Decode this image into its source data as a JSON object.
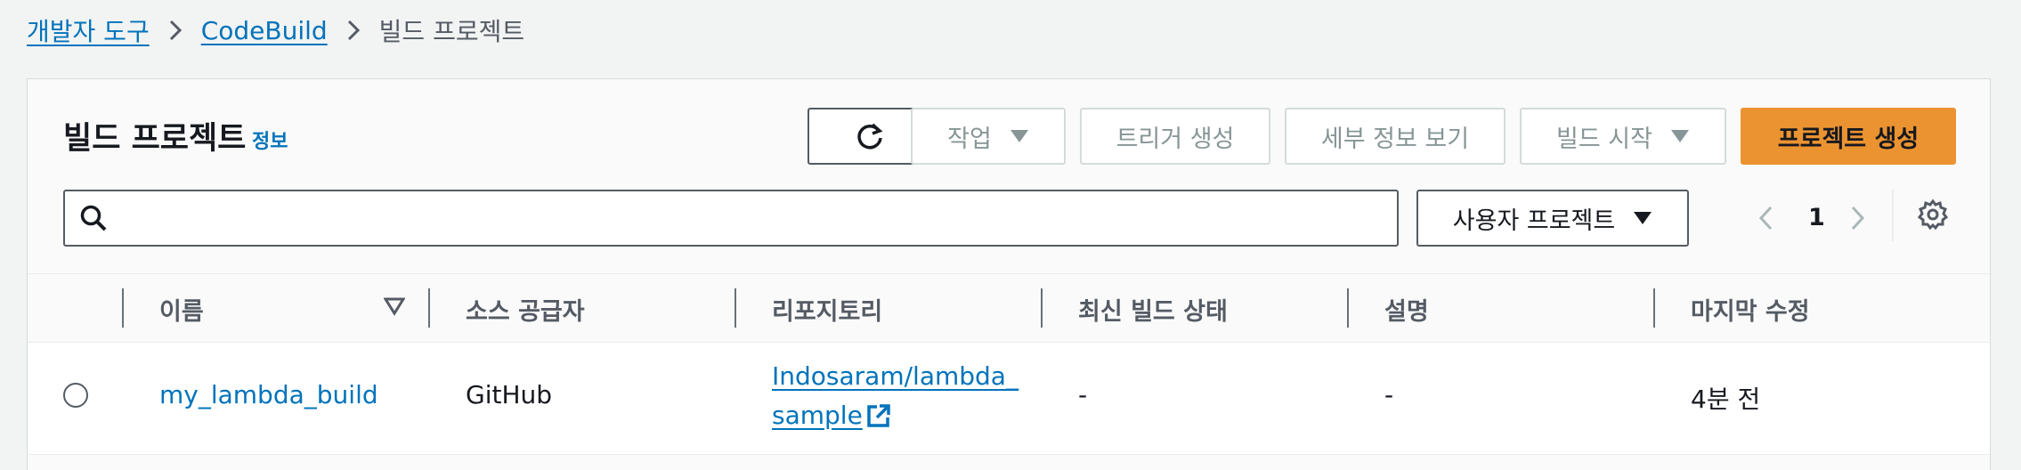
{
  "breadcrumb": {
    "items": [
      "개발자 도구",
      "CodeBuild"
    ],
    "current": "빌드 프로젝트"
  },
  "panel": {
    "title": "빌드 프로젝트",
    "info_link": "정보"
  },
  "toolbar": {
    "action_label": "작업",
    "create_trigger_label": "트리거 생성",
    "view_details_label": "세부 정보 보기",
    "start_build_label": "빌드 시작",
    "create_project_label": "프로젝트 생성"
  },
  "search": {
    "value": "",
    "placeholder": ""
  },
  "filter": {
    "selected": "사용자 프로젝트"
  },
  "pagination": {
    "current_page": "1"
  },
  "table": {
    "columns": [
      "이름",
      "소스 공급자",
      "리포지토리",
      "최신 빌드 상태",
      "설명",
      "마지막 수정"
    ],
    "rows": [
      {
        "name": "my_lambda_build",
        "source_provider": "GitHub",
        "repository_line1": "Indosaram/lambda_",
        "repository_line2": "sample",
        "latest_build_status": "-",
        "description": "-",
        "last_modified": "4분 전"
      }
    ]
  },
  "icons": {
    "refresh": "refresh-icon",
    "search": "search-icon",
    "settings": "gear-icon",
    "external": "external-link-icon",
    "caret": "caret-down-icon"
  },
  "colors": {
    "link": "#0073bb",
    "primary_button": "#ec9331",
    "disabled_text": "#879596",
    "background": "#f2f3f3"
  }
}
